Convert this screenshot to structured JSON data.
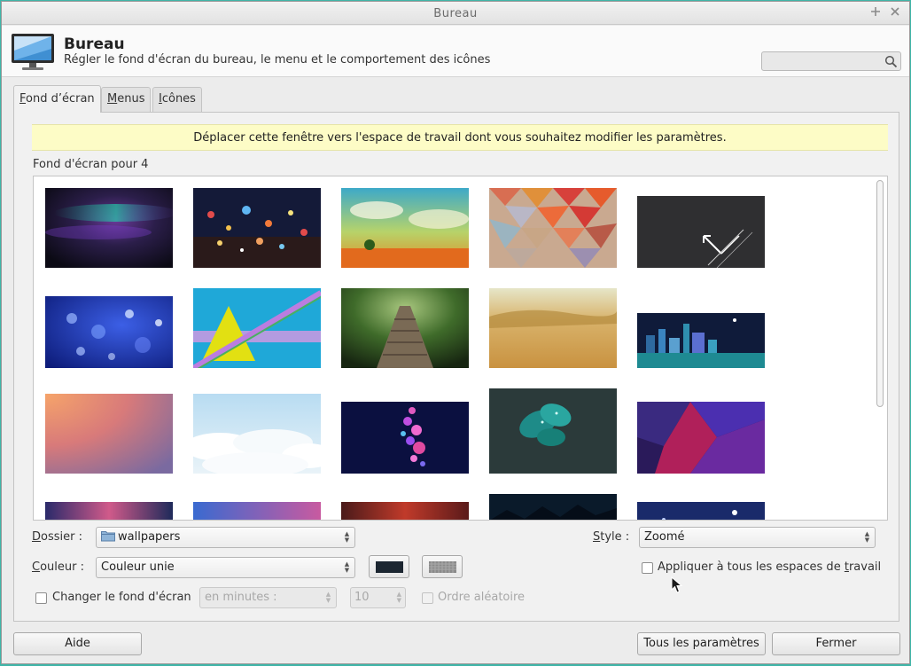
{
  "window": {
    "title": "Bureau",
    "controls": [
      "maximize-icon",
      "close-icon"
    ]
  },
  "header": {
    "title": "Bureau",
    "subtitle": "Régler le fond d'écran du bureau, le menu et le comportement des icônes",
    "search_value": ""
  },
  "tabs": [
    {
      "key": "F",
      "rest": "ond d’écran",
      "active": true
    },
    {
      "key": "M",
      "rest": "enus",
      "active": false
    },
    {
      "key": "I",
      "rest": "cônes",
      "active": false
    }
  ],
  "main": {
    "banner": "Déplacer cette fenêtre vers l'espace de travail dont vous souhaitez modifier les paramètres.",
    "section_label": "Fond d'écran pour 4",
    "wallpapers_rows": 4,
    "wallpapers_visible": 20
  },
  "controls": {
    "folder_label_key": "D",
    "folder_label_rest": "ossier :",
    "folder_value": "wallpapers",
    "style_label_key": "S",
    "style_label_rest": "tyle :",
    "style_value": "Zoomé",
    "color_label_key": "C",
    "color_label_rest": "ouleur :",
    "color_value": "Couleur unie",
    "primary_color": "#1c2631",
    "apply_all_pre": "Appliquer à tous les espaces de ",
    "apply_all_key": "t",
    "apply_all_post": "ravail",
    "apply_all_checked": false,
    "change_wallpaper_label": "Changer le fond d'écran",
    "change_wallpaper_checked": false,
    "interval_unit": "en minutes :",
    "interval_value": "10",
    "random_order_label": "Ordre aléatoire",
    "random_order_checked": false
  },
  "footer": {
    "help_label": "Aide",
    "all_settings_label": "Tous les paramètres",
    "close_label": "Fermer"
  }
}
